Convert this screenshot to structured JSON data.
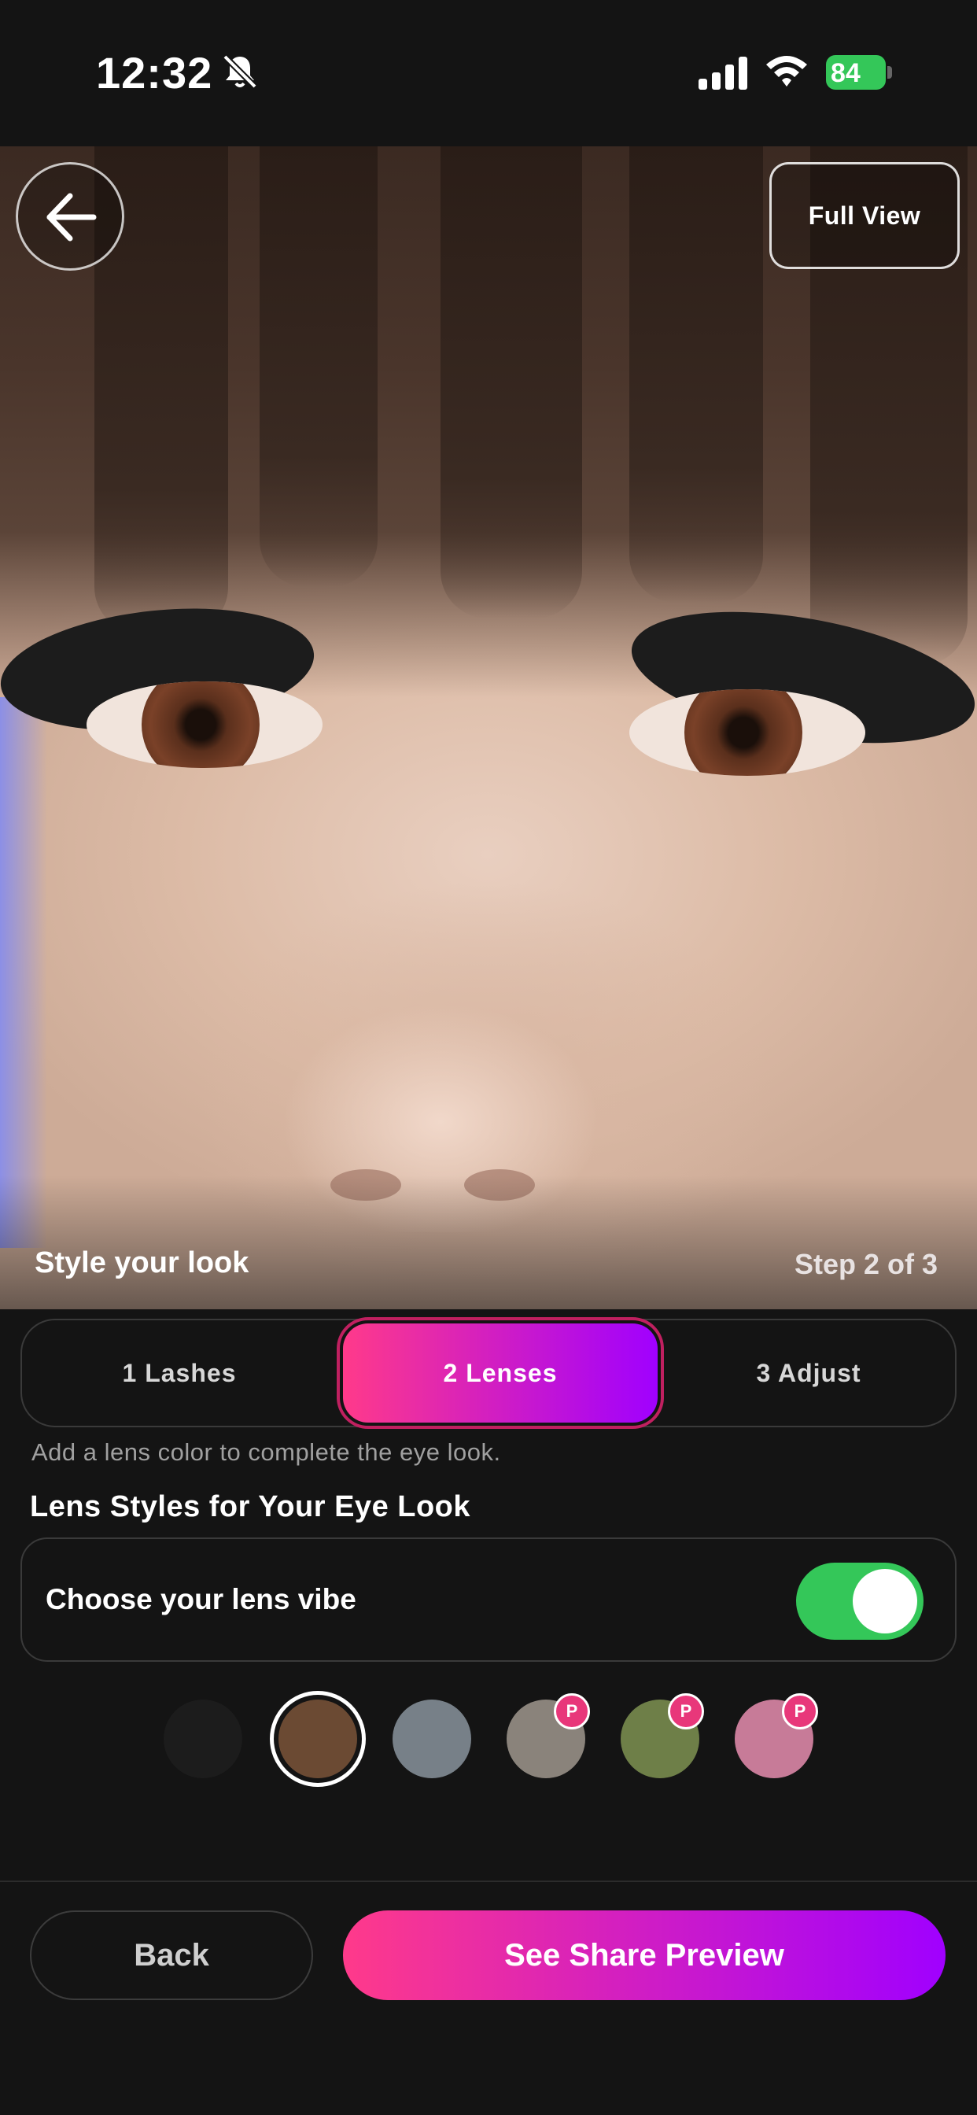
{
  "status_bar": {
    "time": "12:32",
    "battery": "84",
    "icons": [
      "bell-slash-icon",
      "signal-icon",
      "wifi-icon",
      "battery-charging-icon"
    ]
  },
  "photo": {
    "full_view_label": "Full View",
    "style_title": "Style your look",
    "step_text": "Step 2 of 3"
  },
  "tabs": {
    "items": [
      {
        "label": "1  Lashes",
        "active": false
      },
      {
        "label": "2  Lenses",
        "active": true
      },
      {
        "label": "3  Adjust",
        "active": false
      }
    ]
  },
  "hint": "Add a lens color to complete the eye look.",
  "section_title": "Lens Styles for Your Eye Look",
  "vibe": {
    "label": "Choose your lens vibe",
    "toggle_on": true
  },
  "swatches": [
    {
      "color": "#1c1c1c",
      "selected": false,
      "premium": false
    },
    {
      "color": "#6b4a33",
      "selected": true,
      "premium": false
    },
    {
      "color": "#778088",
      "selected": false,
      "premium": false
    },
    {
      "color": "#8a837b",
      "selected": false,
      "premium": true,
      "badge": "P"
    },
    {
      "color": "#6e7f48",
      "selected": false,
      "premium": true,
      "badge": "P"
    },
    {
      "color": "#c77b98",
      "selected": false,
      "premium": true,
      "badge": "P"
    }
  ],
  "footer": {
    "back_label": "Back",
    "share_label": "See Share Preview"
  },
  "colors": {
    "accent_start": "#ff3a8a",
    "accent_end": "#a000ff",
    "toggle_on": "#34c759",
    "background": "#141414"
  }
}
